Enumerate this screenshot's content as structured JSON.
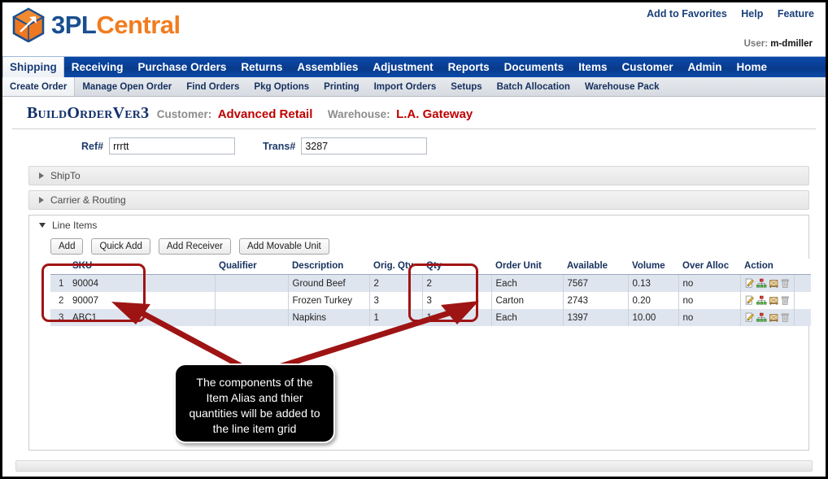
{
  "brand": {
    "name_part1": "3PL",
    "name_part2": "Central",
    "logo_icon": "cube-box-icon",
    "color_blue": "#1a4f8f",
    "color_orange": "#f07d20"
  },
  "header": {
    "links": [
      {
        "label": "Add to Favorites",
        "name": "add-to-favorites-link"
      },
      {
        "label": "Help",
        "name": "help-link"
      },
      {
        "label": "Feature",
        "name": "feature-link"
      }
    ],
    "user_label": "User:",
    "user_name": "m-dmiller"
  },
  "main_nav": [
    {
      "label": "Shipping",
      "active": true
    },
    {
      "label": "Receiving",
      "active": false
    },
    {
      "label": "Purchase Orders",
      "active": false
    },
    {
      "label": "Returns",
      "active": false
    },
    {
      "label": "Assemblies",
      "active": false
    },
    {
      "label": "Adjustment",
      "active": false
    },
    {
      "label": "Reports",
      "active": false
    },
    {
      "label": "Documents",
      "active": false
    },
    {
      "label": "Items",
      "active": false
    },
    {
      "label": "Customer",
      "active": false
    },
    {
      "label": "Admin",
      "active": false
    },
    {
      "label": "Home",
      "active": false
    }
  ],
  "sub_nav": [
    {
      "label": "Create Order",
      "active": true
    },
    {
      "label": "Manage Open Order",
      "active": false
    },
    {
      "label": "Find Orders",
      "active": false
    },
    {
      "label": "Pkg Options",
      "active": false
    },
    {
      "label": "Printing",
      "active": false
    },
    {
      "label": "Import Orders",
      "active": false
    },
    {
      "label": "Setups",
      "active": false
    },
    {
      "label": "Batch Allocation",
      "active": false
    },
    {
      "label": "Warehouse Pack",
      "active": false
    }
  ],
  "page_title": {
    "screen": "BuildOrderVer3",
    "customer_label": "Customer:",
    "customer_value": "Advanced Retail",
    "warehouse_label": "Warehouse:",
    "warehouse_value": "L.A. Gateway"
  },
  "form": {
    "ref_label": "Ref#",
    "ref_value": "rrrtt",
    "ref_placeholder": "",
    "trans_label": "Trans#",
    "trans_value": "3287",
    "trans_placeholder": ""
  },
  "sections": {
    "shipto": "ShipTo",
    "carrier_routing": "Carrier & Routing",
    "line_items": "Line Items"
  },
  "buttons": [
    {
      "label": "Add",
      "name": "add-button"
    },
    {
      "label": "Quick Add",
      "name": "quick-add-button"
    },
    {
      "label": "Add Receiver",
      "name": "add-receiver-button"
    },
    {
      "label": "Add Movable Unit",
      "name": "add-movable-unit-button"
    }
  ],
  "grid": {
    "columns": [
      "",
      "SKU",
      "Qualifier",
      "Description",
      "Orig. Qty",
      "Qty",
      "Order Unit",
      "Available",
      "Volume",
      "Over Alloc",
      "Action",
      ""
    ],
    "rows": [
      {
        "num": "1",
        "sku": "90004",
        "qualifier": "",
        "description": "Ground Beef",
        "orig_qty": "2",
        "qty": "2",
        "order_unit": "Each",
        "available": "7567",
        "volume": "0.13",
        "over_alloc": "no"
      },
      {
        "num": "2",
        "sku": "90007",
        "qualifier": "",
        "description": "Frozen Turkey",
        "orig_qty": "3",
        "qty": "3",
        "order_unit": "Carton",
        "available": "2743",
        "volume": "0.20",
        "over_alloc": "no"
      },
      {
        "num": "3",
        "sku": "ABC1",
        "qualifier": "",
        "description": "Napkins",
        "orig_qty": "1",
        "qty": "1",
        "order_unit": "Each",
        "available": "1397",
        "volume": "10.00",
        "over_alloc": "no"
      }
    ],
    "action_icons": [
      "edit-pencil-icon",
      "hierarchy-tree-icon",
      "movable-unit-icon",
      "delete-trash-icon"
    ]
  },
  "annotation": {
    "callout_text": "The components of the Item Alias and thier quantities will be added to the line item grid",
    "highlight_color": "#a01414",
    "arrow_color": "#9e1414",
    "highlighted_columns": [
      "SKU",
      "Qty"
    ]
  }
}
